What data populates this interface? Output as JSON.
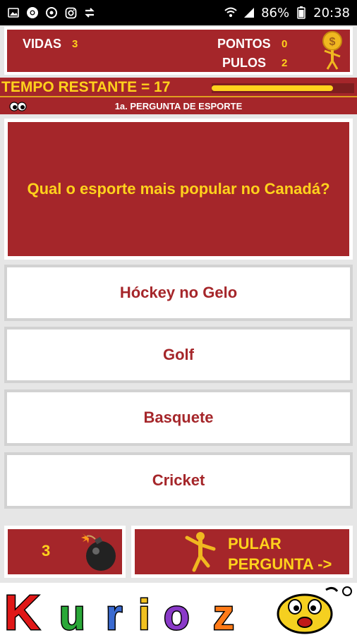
{
  "status_bar": {
    "battery": "86%",
    "time": "20:38",
    "icons": [
      "image-icon",
      "chrome-icon",
      "sync-icon",
      "instagram-icon",
      "transfer-icon",
      "wifi-icon",
      "signal-icon",
      "battery-icon"
    ]
  },
  "stats": {
    "lives_label": "VIDAS",
    "lives_value": "3",
    "points_label": "PONTOS",
    "points_value": "0",
    "skips_label": "PULOS",
    "skips_value": "2"
  },
  "timer": {
    "text": "TEMPO RESTANTE = 17",
    "progress": 0.85,
    "question_label": "1a. PERGUNTA DE ESPORTE"
  },
  "question": {
    "text": "Qual o esporte mais popular no Canadá?"
  },
  "answers": [
    {
      "label": "Hóckey no Gelo"
    },
    {
      "label": "Golf"
    },
    {
      "label": "Basquete"
    },
    {
      "label": "Cricket"
    }
  ],
  "bomb": {
    "count": "3"
  },
  "skip": {
    "line1": "PULAR",
    "line2": "PERGUNTA ->"
  },
  "logo": {
    "text": "Kuriozo"
  },
  "colors": {
    "panel": "#a5262a",
    "accent": "#ffd21c",
    "answer_text": "#a5262a",
    "background": "#e6e6e6"
  }
}
